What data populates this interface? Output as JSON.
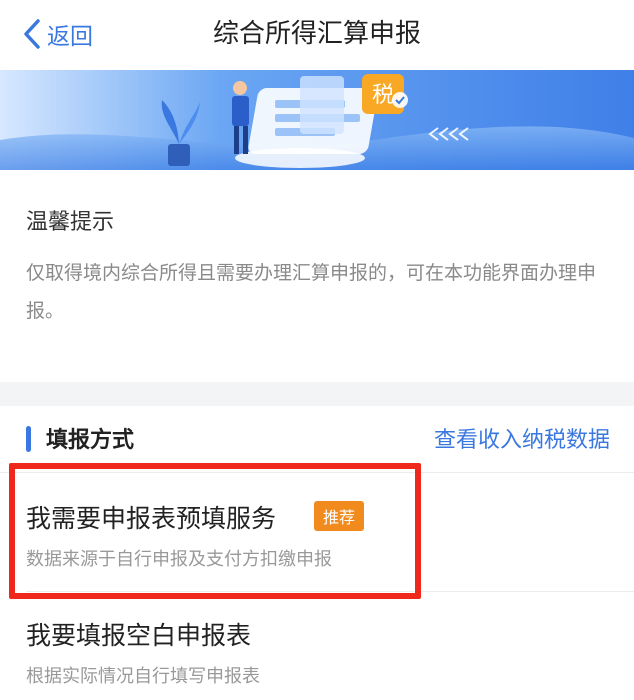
{
  "nav": {
    "back_label": "返回",
    "title": "综合所得汇算申报"
  },
  "banner": {
    "tax_char": "税"
  },
  "tips": {
    "title": "温馨提示",
    "body": "仅取得境内综合所得且需要办理汇算申报的，可在本功能界面办理申报。"
  },
  "section": {
    "title": "填报方式",
    "link": "查看收入纳税数据"
  },
  "options": [
    {
      "title": "我需要申报表预填服务",
      "badge": "推荐",
      "subtitle": "数据来源于自行申报及支付方扣缴申报"
    },
    {
      "title": "我要填报空白申报表",
      "subtitle": "根据实际情况自行填写申报表"
    }
  ],
  "colors": {
    "accent": "#3a78e0",
    "badge": "#f18b1e",
    "highlight": "#f0281c"
  }
}
